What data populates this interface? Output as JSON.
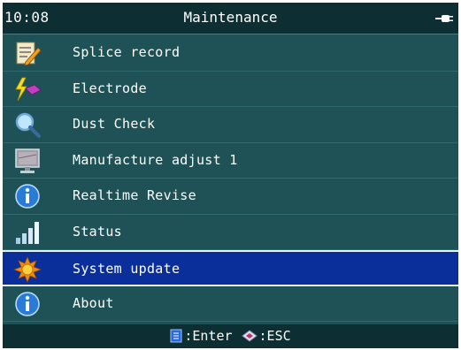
{
  "status_bar": {
    "time": "10:08",
    "title": "Maintenance",
    "power_icon": "plug-icon"
  },
  "menu": {
    "items": [
      {
        "label": "Splice record",
        "icon": "notepad-pencil-icon"
      },
      {
        "label": "Electrode",
        "icon": "lightning-electrode-icon"
      },
      {
        "label": "Dust Check",
        "icon": "magnifier-icon"
      },
      {
        "label": "Manufacture adjust 1",
        "icon": "monitor-icon"
      },
      {
        "label": "Realtime Revise",
        "icon": "info-icon"
      },
      {
        "label": "Status",
        "icon": "signal-bars-icon"
      },
      {
        "label": "System update",
        "icon": "gear-sun-icon",
        "selected": true
      },
      {
        "label": "About",
        "icon": "info-icon"
      }
    ]
  },
  "footer": {
    "enter_label": ":Enter",
    "esc_label": ":ESC"
  },
  "colors": {
    "background": "#1f5256",
    "header": "#0d2f33",
    "selected": "#0a2f9a"
  }
}
